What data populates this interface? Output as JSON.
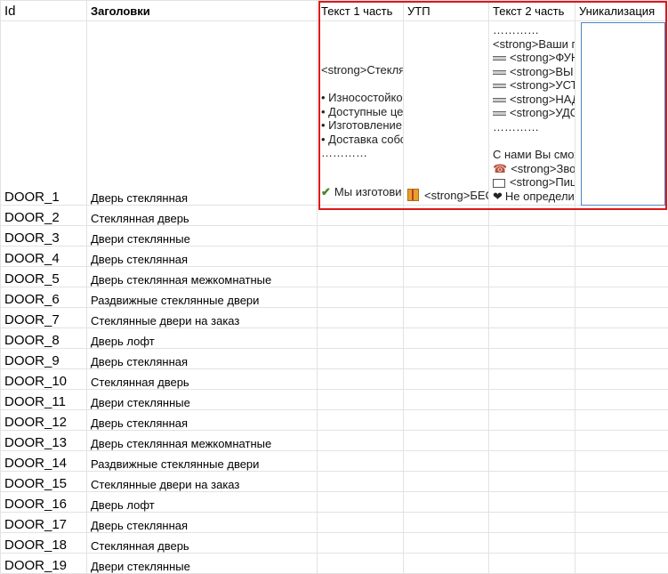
{
  "headers": {
    "id": "Id",
    "title": "Заголовки",
    "text1": "Текст 1 часть",
    "utp": "УТП",
    "text2": "Текст 2 часть",
    "uniq": "Уникализация"
  },
  "preview": {
    "text1": {
      "line_strong": "<strong>Стекля",
      "bullet1": "• Износостойкое",
      "bullet2": "• Доступные цен",
      "bullet3": "• Изготовление",
      "bullet4": "• Доставка собс",
      "dots": "…………",
      "check_line": "Мы изготови"
    },
    "utp": {
      "line": "<strong>БЕС"
    },
    "text2": {
      "dots_top": "…………",
      "l1": "<strong>Ваши п",
      "l2": "<strong>ФУН",
      "l3": "<strong>ВЫ",
      "l4": "<strong>УСТ",
      "l5": "<strong>НАД",
      "l6": "<strong>УДС",
      "dots_mid": "…………",
      "l7": "С нами Вы смож",
      "l8": "<strong>Зво",
      "l9": "<strong>Пиц",
      "l10": "Не определи"
    }
  },
  "rows": [
    {
      "id": "DOOR_1",
      "title": "Дверь стеклянная"
    },
    {
      "id": "DOOR_2",
      "title": "Стеклянная дверь"
    },
    {
      "id": "DOOR_3",
      "title": "Двери стеклянные"
    },
    {
      "id": "DOOR_4",
      "title": "Дверь стеклянная"
    },
    {
      "id": "DOOR_5",
      "title": "Дверь стеклянная межкомнатные"
    },
    {
      "id": "DOOR_6",
      "title": "Раздвижные стеклянные двери"
    },
    {
      "id": "DOOR_7",
      "title": "Стеклянные двери на заказ"
    },
    {
      "id": "DOOR_8",
      "title": "Дверь лофт"
    },
    {
      "id": "DOOR_9",
      "title": "Дверь стеклянная"
    },
    {
      "id": "DOOR_10",
      "title": "Стеклянная дверь"
    },
    {
      "id": "DOOR_11",
      "title": "Двери стеклянные"
    },
    {
      "id": "DOOR_12",
      "title": "Дверь стеклянная"
    },
    {
      "id": "DOOR_13",
      "title": "Дверь стеклянная межкомнатные"
    },
    {
      "id": "DOOR_14",
      "title": "Раздвижные стеклянные двери"
    },
    {
      "id": "DOOR_15",
      "title": "Стеклянные двери на заказ"
    },
    {
      "id": "DOOR_16",
      "title": "Дверь лофт"
    },
    {
      "id": "DOOR_17",
      "title": "Дверь стеклянная"
    },
    {
      "id": "DOOR_18",
      "title": "Стеклянная дверь"
    },
    {
      "id": "DOOR_19",
      "title": "Двери стеклянные"
    }
  ],
  "colors": {
    "highlight_frame": "#e0161c",
    "selection": "#4a86c6",
    "grid": "#e2e2e2"
  }
}
